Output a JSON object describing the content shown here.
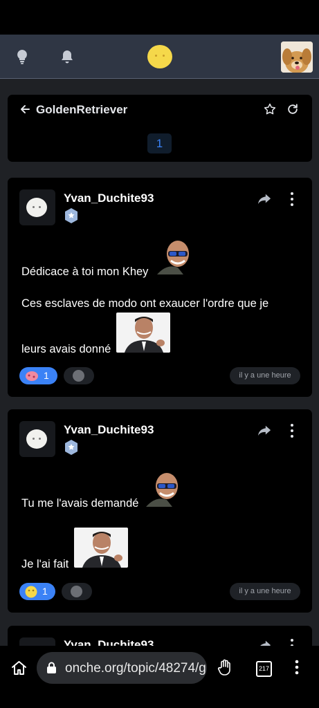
{
  "topic": {
    "title": "GoldenRetriever",
    "page": "1"
  },
  "posts": [
    {
      "username": "Yvan_Duchite93",
      "lines": [
        "Dédicace à toi mon Khey",
        "Ces esclaves de modo ont exaucer l'ordre que je",
        "leurs avais donné"
      ],
      "reaction_count": "1",
      "time": "il y a une heure"
    },
    {
      "username": "Yvan_Duchite93",
      "lines": [
        "Tu me l'avais demandé",
        "Je l'ai fait"
      ],
      "reaction_count": "1",
      "time": "il y a une heure"
    },
    {
      "username": "Yvan_Duchite93"
    }
  ],
  "browser": {
    "url": "onche.org/topic/48274/g",
    "tab_count": "217"
  },
  "colors": {
    "accent": "#3b82f6",
    "nav_bg": "#2f3644",
    "card_bg": "#000000",
    "page_bg": "#1f2125"
  },
  "icons": [
    "lightbulb-icon",
    "bell-icon",
    "back-arrow-icon",
    "star-icon",
    "refresh-icon",
    "share-icon",
    "more-icon",
    "home-icon",
    "lock-icon",
    "hand-icon",
    "tabs-icon"
  ]
}
